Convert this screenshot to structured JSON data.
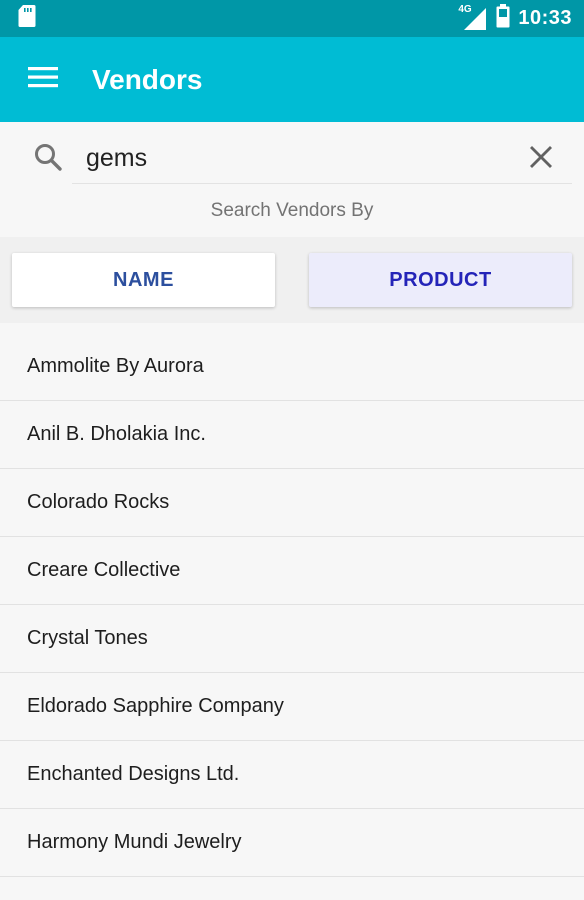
{
  "status_bar": {
    "network": "4G",
    "time": "10:33"
  },
  "app_bar": {
    "title": "Vendors"
  },
  "search": {
    "value": "gems",
    "label": "Search Vendors By"
  },
  "toggle": {
    "name_label": "NAME",
    "product_label": "PRODUCT",
    "selected": "PRODUCT"
  },
  "vendors": [
    "Ammolite By Aurora",
    "Anil B. Dholakia Inc.",
    "Colorado Rocks",
    "Creare Collective",
    "Crystal Tones",
    "Eldorado Sapphire Company",
    "Enchanted Designs Ltd.",
    "Harmony Mundi Jewelry"
  ],
  "colors": {
    "status_bar": "#0097a7",
    "app_bar": "#00bcd4",
    "name_text": "#2c4f9e",
    "product_text": "#2424b8",
    "product_bg": "#ececfb"
  }
}
